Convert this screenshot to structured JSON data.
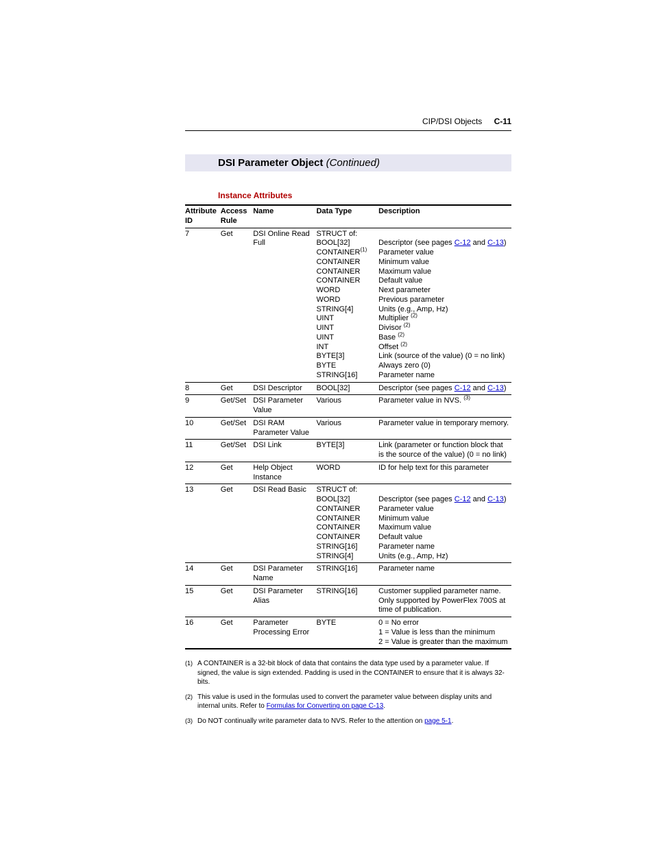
{
  "header": {
    "section": "CIP/DSI Objects",
    "page": "C-11"
  },
  "title": {
    "main": "DSI Parameter Object",
    "cont": "(Continued)"
  },
  "subhead": "Instance Attributes",
  "columns": [
    "Attribute ID",
    "Access Rule",
    "Name",
    "Data Type",
    "Description"
  ],
  "rows": [
    {
      "id": "7",
      "access": "Get",
      "name": "DSI Online Read Full",
      "dt": [
        "STRUCT of:",
        "BOOL[32]",
        "CONTAINER",
        "CONTAINER",
        "CONTAINER",
        "CONTAINER",
        "WORD",
        "WORD",
        "STRING[4]",
        "UINT",
        "UINT",
        "UINT",
        "INT",
        "BYTE[3]",
        "BYTE",
        "STRING[16]"
      ],
      "dt_sup": {
        "2": "(1)"
      },
      "desc": [
        "",
        "Descriptor (see pages |C-12| and |C-13|)",
        "Parameter value",
        "Minimum value",
        "Maximum value",
        "Default value",
        "Next parameter",
        "Previous parameter",
        "Units (e.g., Amp, Hz)",
        "Multiplier ^(2)",
        "Divisor ^(2)",
        "Base ^(2)",
        "Offset ^(2)",
        "Link (source of the value) (0 = no link)",
        "Always zero (0)",
        "Parameter name"
      ]
    },
    {
      "id": "8",
      "access": "Get",
      "name": "DSI Descriptor",
      "dt": [
        "BOOL[32]"
      ],
      "desc": [
        "Descriptor (see pages |C-12| and |C-13|)"
      ]
    },
    {
      "id": "9",
      "access": "Get/Set",
      "name": "DSI Parameter Value",
      "dt": [
        "Various"
      ],
      "desc": [
        "Parameter value in NVS. ^(3)"
      ]
    },
    {
      "id": "10",
      "access": "Get/Set",
      "name": "DSI RAM Parameter Value",
      "dt": [
        "Various"
      ],
      "desc": [
        "Parameter value in temporary memory."
      ]
    },
    {
      "id": "11",
      "access": "Get/Set",
      "name": "DSI Link",
      "dt": [
        "BYTE[3]"
      ],
      "desc": [
        "Link (parameter or function block that is the source of the value) (0 = no link)"
      ]
    },
    {
      "id": "12",
      "access": "Get",
      "name": "Help Object Instance",
      "dt": [
        "WORD"
      ],
      "desc": [
        "ID for help text for this parameter"
      ]
    },
    {
      "id": "13",
      "access": "Get",
      "name": "DSI Read Basic",
      "dt": [
        "STRUCT of:",
        "BOOL[32]",
        "CONTAINER",
        "CONTAINER",
        "CONTAINER",
        "CONTAINER",
        "STRING[16]",
        "STRING[4]"
      ],
      "desc": [
        "",
        "Descriptor (see pages |C-12| and |C-13|)",
        "Parameter value",
        "Minimum value",
        "Maximum value",
        "Default value",
        "Parameter name",
        "Units (e.g., Amp, Hz)"
      ]
    },
    {
      "id": "14",
      "access": "Get",
      "name": "DSI Parameter Name",
      "dt": [
        "STRING[16]"
      ],
      "desc": [
        "Parameter name"
      ]
    },
    {
      "id": "15",
      "access": "Get",
      "name": "DSI Parameter Alias",
      "dt": [
        "STRING[16]"
      ],
      "desc": [
        "Customer supplied parameter name. Only supported by PowerFlex 700S at time of publication."
      ]
    },
    {
      "id": "16",
      "access": "Get",
      "name": "Parameter Processing Error",
      "dt": [
        "BYTE"
      ],
      "desc": [
        "0 = No error",
        "1 = Value is less than the minimum",
        "2 = Value is greater than the maximum"
      ]
    }
  ],
  "footnotes": [
    {
      "num": "(1)",
      "text": "A CONTAINER is a 32-bit block of data that contains the data type used by a parameter value. If signed, the value is sign extended. Padding is used in the CONTAINER to ensure that it is always 32-bits."
    },
    {
      "num": "(2)",
      "text": "This value is used in the formulas used to convert the parameter value between display units and internal units. Refer to |Formulas for Converting on page C-13|."
    },
    {
      "num": "(3)",
      "text": "Do NOT continually write parameter data to NVS. Refer to the attention on |page 5-1|."
    }
  ]
}
